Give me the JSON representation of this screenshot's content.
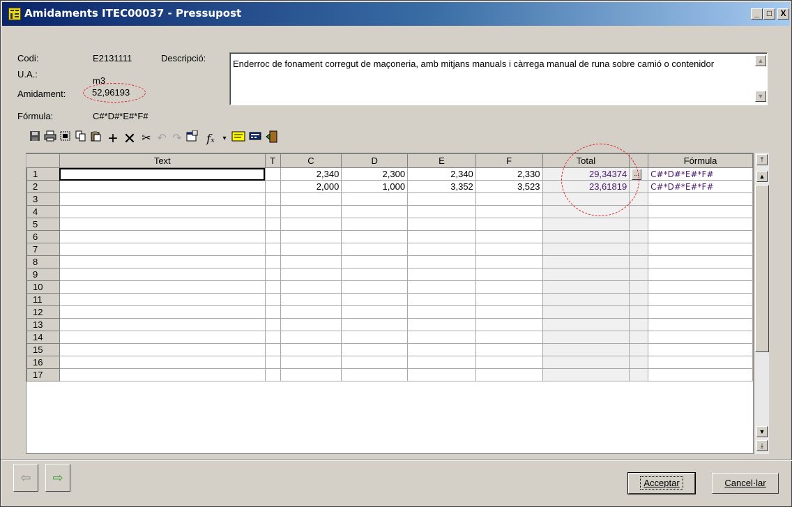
{
  "window": {
    "title": "Amidaments ITEC00037 - Pressupost"
  },
  "controls": {
    "minimize": "_",
    "maximize": "□",
    "close": "X"
  },
  "info": {
    "codi_label": "Codi:",
    "codi_value": "E2131111",
    "ua_label": "U.A.:",
    "ua_value": "m3",
    "amidament_label": "Amidament:",
    "amidament_value": "52,96193",
    "formula_label": "Fórmula:",
    "formula_value": "C#*D#*E#*F#",
    "descripcio_label": "Descripció:",
    "descripcio_text": "Enderroc de fonament corregut de maçoneria, amb mitjans manuals i càrrega manual de runa sobre camió o contenidor"
  },
  "toolbar": {
    "icons": [
      "save-icon",
      "print-icon",
      "select-icon",
      "copy-icon",
      "paste-icon",
      "add-icon",
      "delete-icon",
      "cut-icon",
      "undo-icon",
      "redo-icon",
      "properties-icon",
      "function-icon",
      "dropdown-icon",
      "highlight-icon",
      "calculator-icon",
      "exit-icon"
    ]
  },
  "grid": {
    "columns": [
      "Text",
      "T",
      "C",
      "D",
      "E",
      "F",
      "Total",
      "",
      "Fórmula"
    ],
    "rows": [
      {
        "n": "1",
        "text": "",
        "t": "",
        "c": "2,340",
        "d": "2,300",
        "e": "2,340",
        "f": "2,330",
        "total": "29,34374",
        "btn": "...",
        "formula": "C#*D#*E#*F#"
      },
      {
        "n": "2",
        "text": "",
        "t": "",
        "c": "2,000",
        "d": "1,000",
        "e": "3,352",
        "f": "3,523",
        "total": "23,61819",
        "btn": "",
        "formula": "C#*D#*E#*F#"
      },
      {
        "n": "3"
      },
      {
        "n": "4"
      },
      {
        "n": "5"
      },
      {
        "n": "6"
      },
      {
        "n": "7"
      },
      {
        "n": "8"
      },
      {
        "n": "9"
      },
      {
        "n": "10"
      },
      {
        "n": "11"
      },
      {
        "n": "12"
      },
      {
        "n": "13"
      },
      {
        "n": "14"
      },
      {
        "n": "15"
      },
      {
        "n": "16"
      },
      {
        "n": "17"
      }
    ]
  },
  "buttons": {
    "accept": "Acceptar",
    "cancel": "Cancel·lar"
  },
  "colors": {
    "title_gradient_start": "#0a246a",
    "annotation_circle": "#e0202a",
    "formula_text": "#4b1a6e"
  }
}
